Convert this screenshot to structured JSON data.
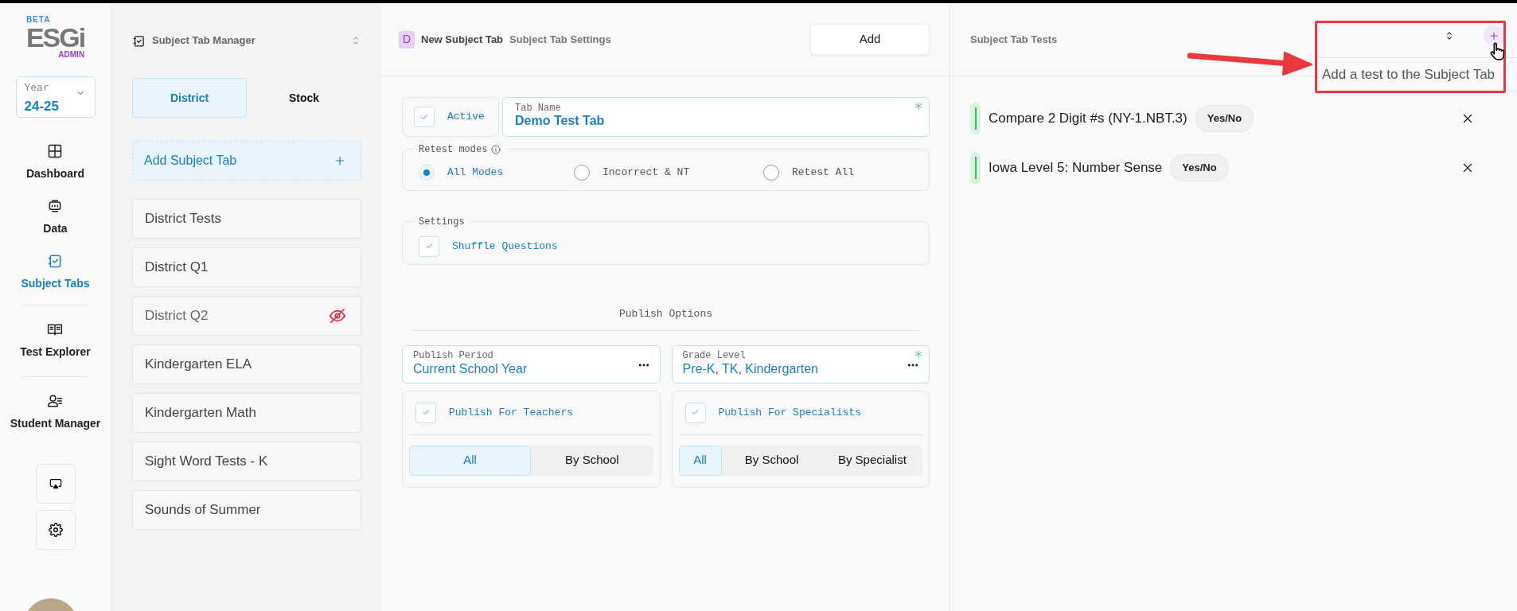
{
  "logo": {
    "badge": "BETA",
    "name": "ESGi",
    "sub": "ADMIN"
  },
  "year": {
    "label": "Year",
    "value": "24-25"
  },
  "nav": [
    {
      "label": "Dashboard",
      "selected": false
    },
    {
      "label": "Data",
      "selected": false
    },
    {
      "label": "Subject Tabs",
      "selected": true
    },
    {
      "label": "Test Explorer",
      "selected": false
    },
    {
      "label": "Student Manager",
      "selected": false
    }
  ],
  "manager": {
    "title": "Subject Tab Manager",
    "tabs": [
      {
        "label": "District",
        "selected": true
      },
      {
        "label": "Stock",
        "selected": false
      }
    ],
    "add_label": "Add Subject Tab",
    "items": [
      {
        "label": "District Tests",
        "hidden": false
      },
      {
        "label": "District Q1",
        "hidden": false
      },
      {
        "label": "District Q2",
        "hidden": true
      },
      {
        "label": "Kindergarten ELA",
        "hidden": false
      },
      {
        "label": "Kindergarten Math",
        "hidden": false
      },
      {
        "label": "Sight Word Tests - K",
        "hidden": false
      },
      {
        "label": "Sounds of Summer",
        "hidden": false
      }
    ]
  },
  "editor": {
    "badge": "D",
    "title": "New Subject Tab",
    "subtitle": "Subject Tab Settings",
    "add_button": "Add",
    "active": {
      "label": "Active",
      "checked": true
    },
    "tab_name": {
      "label": "Tab Name",
      "value": "Demo Test Tab",
      "required": true
    },
    "retest": {
      "legend": "Retest modes",
      "options": [
        {
          "label": "All Modes",
          "selected": true
        },
        {
          "label": "Incorrect & NT",
          "selected": false
        },
        {
          "label": "Retest All",
          "selected": false
        }
      ]
    },
    "settings": {
      "legend": "Settings",
      "options": [
        {
          "label": "Shuffle Questions",
          "checked": true
        }
      ]
    },
    "publish": {
      "heading": "Publish Options",
      "fields": [
        {
          "label": "Publish Period",
          "value": "Current School Year",
          "required": false
        },
        {
          "label": "Grade Level",
          "value": "Pre-K, TK, Kindergarten",
          "required": true
        }
      ],
      "groups": [
        {
          "label": "Publish For Teachers",
          "checked": true,
          "options": [
            {
              "label": "All",
              "selected": true
            },
            {
              "label": "By School",
              "selected": false
            }
          ]
        },
        {
          "label": "Publish For Specialists",
          "checked": true,
          "options": [
            {
              "label": "All",
              "selected": true
            },
            {
              "label": "By School",
              "selected": false
            },
            {
              "label": "By Specialist",
              "selected": false
            }
          ]
        }
      ]
    }
  },
  "tests_panel": {
    "title": "Subject Tab Tests",
    "tooltip": "Add a test to the Subject Tab",
    "tests": [
      {
        "name": "Compare 2 Digit #s (NY-1.NBT.3)",
        "type": "Yes/No"
      },
      {
        "name": "Iowa Level 5: Number Sense",
        "type": "Yes/No"
      }
    ]
  }
}
